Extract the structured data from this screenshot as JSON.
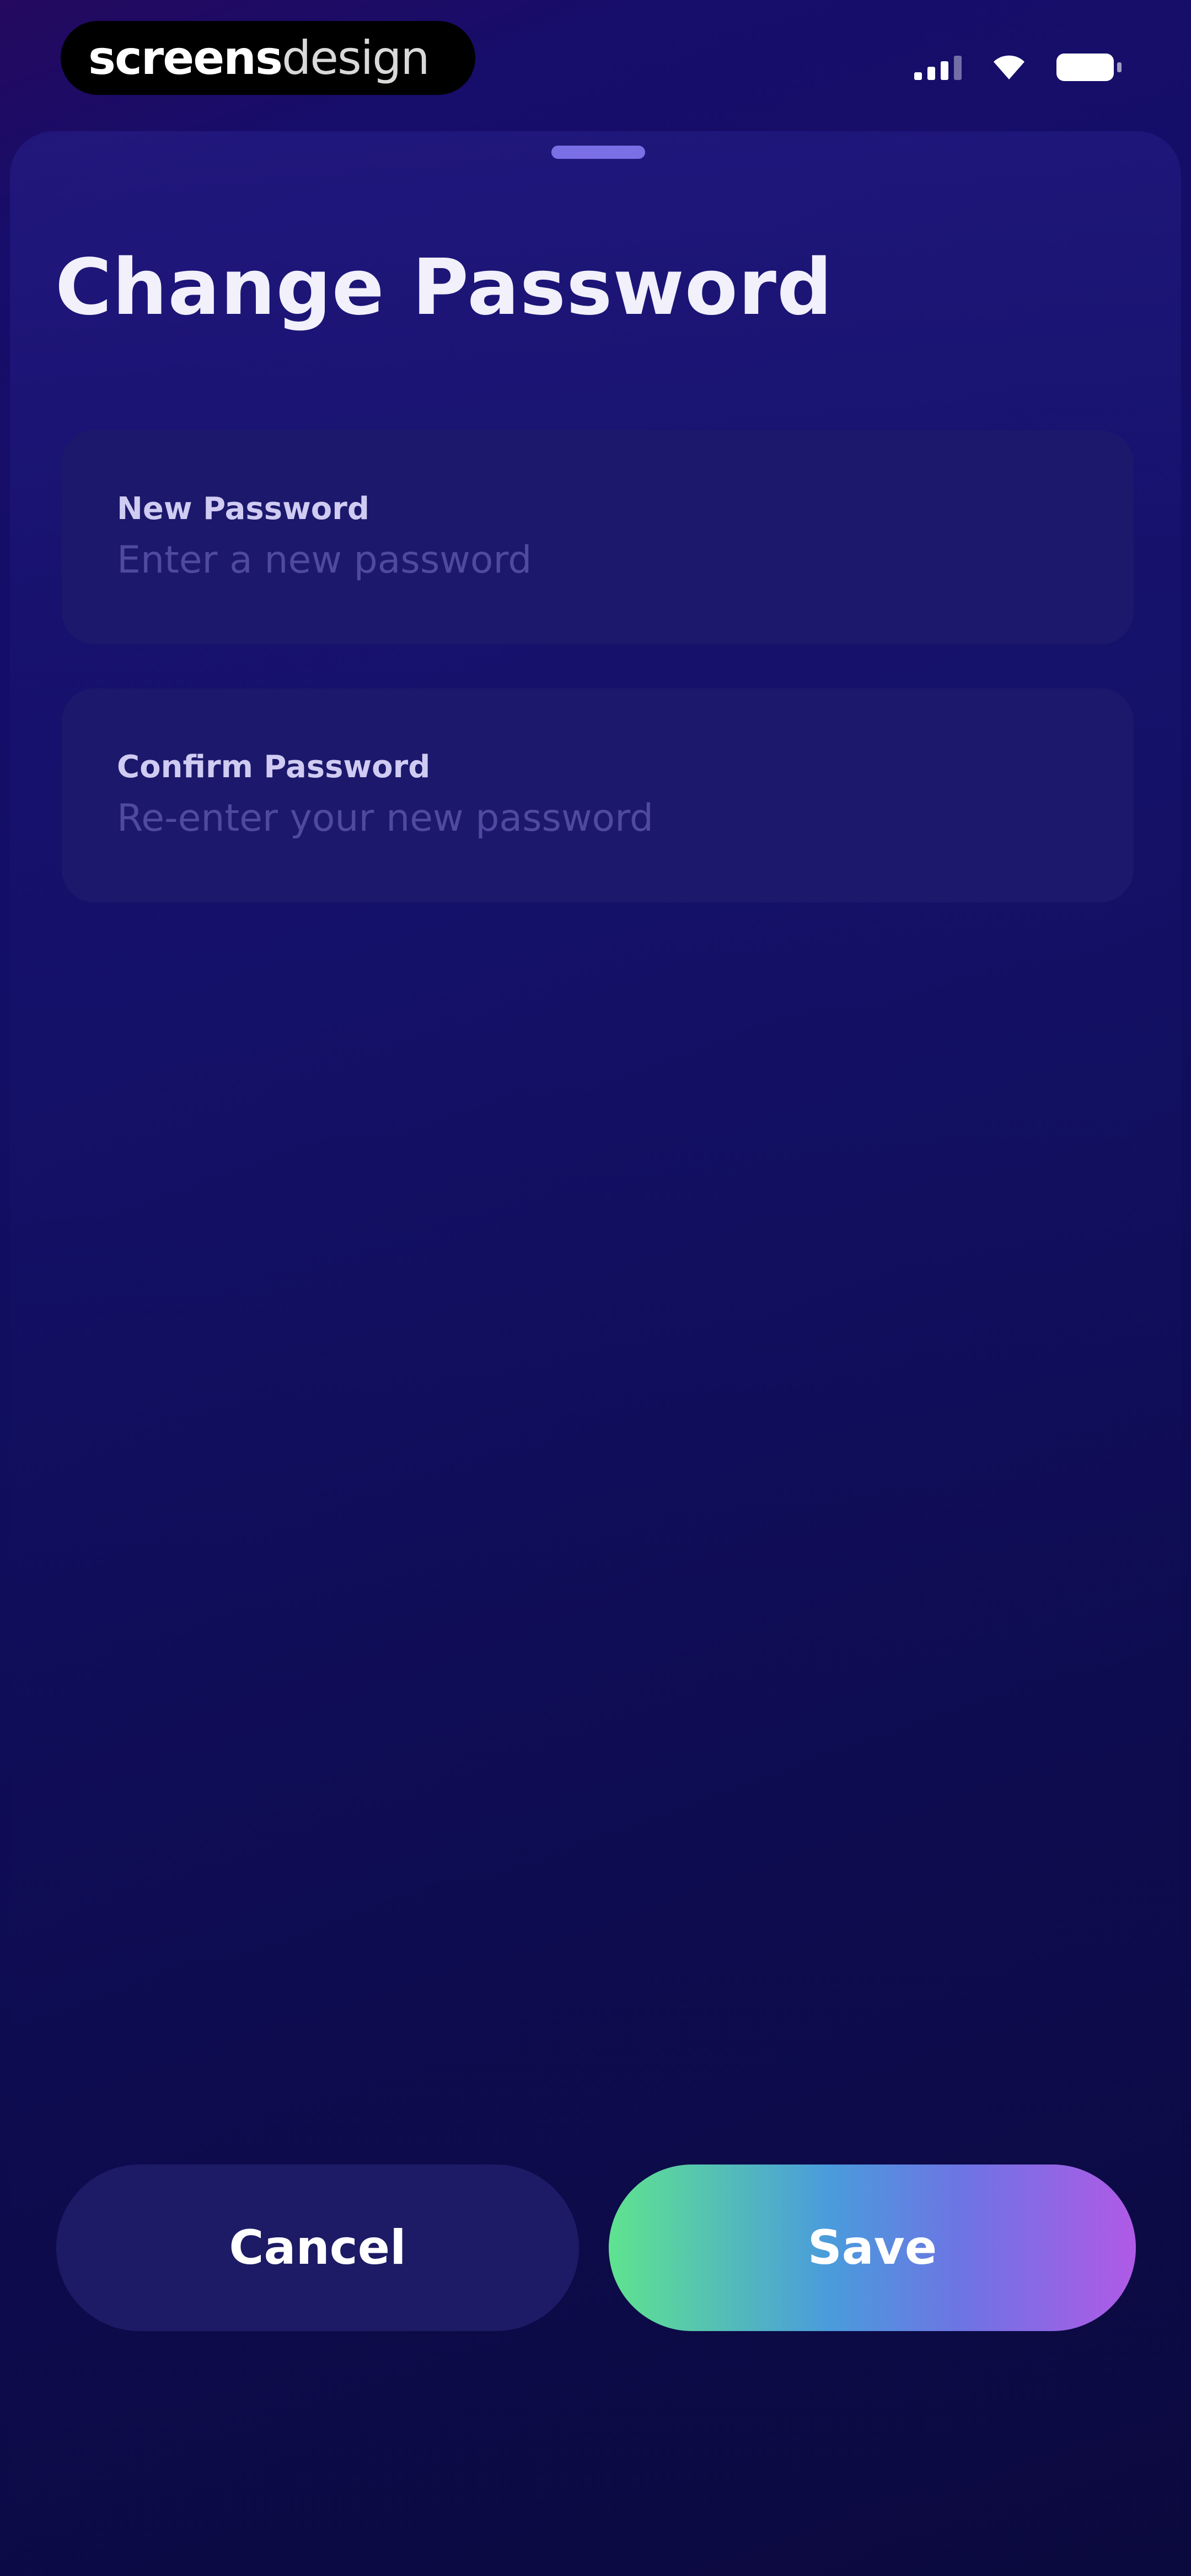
{
  "status_bar": {
    "brand_bold": "screens",
    "brand_light": "design"
  },
  "sheet": {
    "title": "Change Password"
  },
  "form": {
    "new_password": {
      "label": "New Password",
      "value": "",
      "placeholder": "Enter a new password"
    },
    "confirm_password": {
      "label": "Confirm Password",
      "value": "",
      "placeholder": "Re-enter your new password"
    }
  },
  "actions": {
    "cancel_label": "Cancel",
    "save_label": "Save"
  },
  "icons": {
    "signal": "cellular-signal-icon",
    "wifi": "wifi-icon",
    "battery": "battery-icon"
  },
  "colors": {
    "background": "#120f66",
    "field": "#1c186b",
    "cancel": "#1d1b66",
    "save_gradient": [
      "#5fe38f",
      "#4a9bdc",
      "#b05ae6"
    ]
  }
}
